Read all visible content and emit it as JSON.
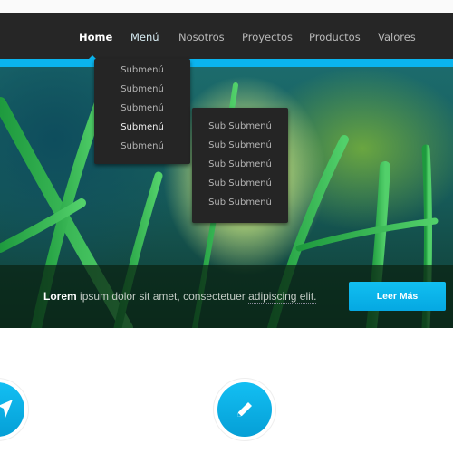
{
  "nav": {
    "items": [
      {
        "label": "Home",
        "active": true
      },
      {
        "label": "Menú"
      },
      {
        "label": "Nosotros"
      },
      {
        "label": "Proyectos"
      },
      {
        "label": "Productos"
      },
      {
        "label": "Valores"
      }
    ]
  },
  "submenu": {
    "items": [
      "Submenú",
      "Submenú",
      "Submenú",
      "Submenú",
      "Submenú"
    ]
  },
  "subsubmenu": {
    "items": [
      "Sub Submenú",
      "Sub Submenú",
      "Sub Submenú",
      "Sub Submenú",
      "Sub Submenú"
    ]
  },
  "caption": {
    "bold": "Lorem",
    "text": " ipsum dolor sit amet, consectetuer ",
    "underlined": "adipiscing elit.",
    "button": "Leer Más"
  },
  "features": [
    {
      "icon": "paper-plane-icon"
    },
    {
      "icon": "pencil-icon"
    }
  ],
  "colors": {
    "accent": "#0ab4ee",
    "nav_bg": "#262626"
  }
}
